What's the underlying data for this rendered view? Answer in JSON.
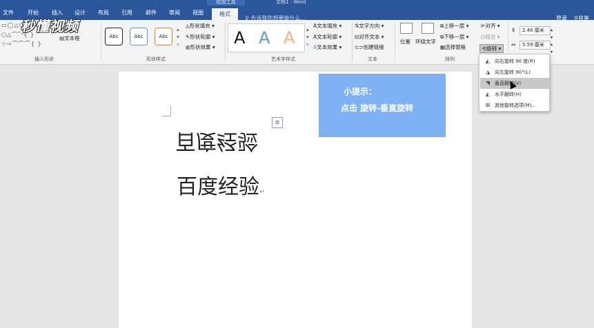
{
  "window": {
    "context_label": "绘图工具",
    "doc_title": "文档1 - Word",
    "login": "登录",
    "share": "共享"
  },
  "tabs": [
    "文件",
    "开始",
    "插入",
    "设计",
    "布局",
    "引用",
    "邮件",
    "审阅",
    "视图"
  ],
  "active_tab": "格式",
  "tellme": "告诉我您想要做什么...",
  "ribbon": {
    "insert_shapes": {
      "label": "插入形状",
      "row1": "▭◯△⬠⬡⇨⇩",
      "row2": "⬡△⌒⎴◝{ }",
      "row3": "☆⇨⌒⌒⌒{ }",
      "textbox": "文本框"
    },
    "shape_styles": {
      "label": "形状样式",
      "box_text": "Abc",
      "fill": "形状填充",
      "outline": "形状轮廓",
      "effect": "形状效果"
    },
    "wordart": {
      "label": "艺术字样式",
      "letter": "A",
      "text_fill": "文本填充",
      "text_outline": "文本轮廓",
      "text_effect": "文本效果"
    },
    "text": {
      "label": "文本",
      "direction": "文字方向",
      "align": "对齐文本",
      "link": "创建链接"
    },
    "arrange": {
      "label": "排列",
      "position": "位置",
      "wrap": "环绕文字",
      "forward": "上移一层",
      "backward": "下移一层",
      "selection": "选择窗格",
      "align": "对齐",
      "group": "组合",
      "rotate": "旋转"
    },
    "size": {
      "height": "2.46 厘米",
      "width": "5.59 厘米"
    }
  },
  "watermark": "秒懂视频",
  "document": {
    "flipped_text": "百度经验",
    "normal_text": "百度经验",
    "tip_title": "小提示：",
    "tip_body": "点击 旋转-垂直旋转"
  },
  "rotate_menu": [
    {
      "label": "向右旋转 90 度(R)",
      "icon": "rotate-right-icon"
    },
    {
      "label": "向左旋转 90°(L)",
      "icon": "rotate-left-icon"
    },
    {
      "label": "垂直翻转(V)",
      "icon": "flip-vertical-icon"
    },
    {
      "label": "水平翻转(H)",
      "icon": "flip-horizontal-icon"
    },
    {
      "label": "其他旋转选项(M)...",
      "icon": "more-rotation-icon"
    }
  ],
  "colors": {
    "ribbon_blue": "#2b579a",
    "tip_blue": "#7fb2f5"
  }
}
